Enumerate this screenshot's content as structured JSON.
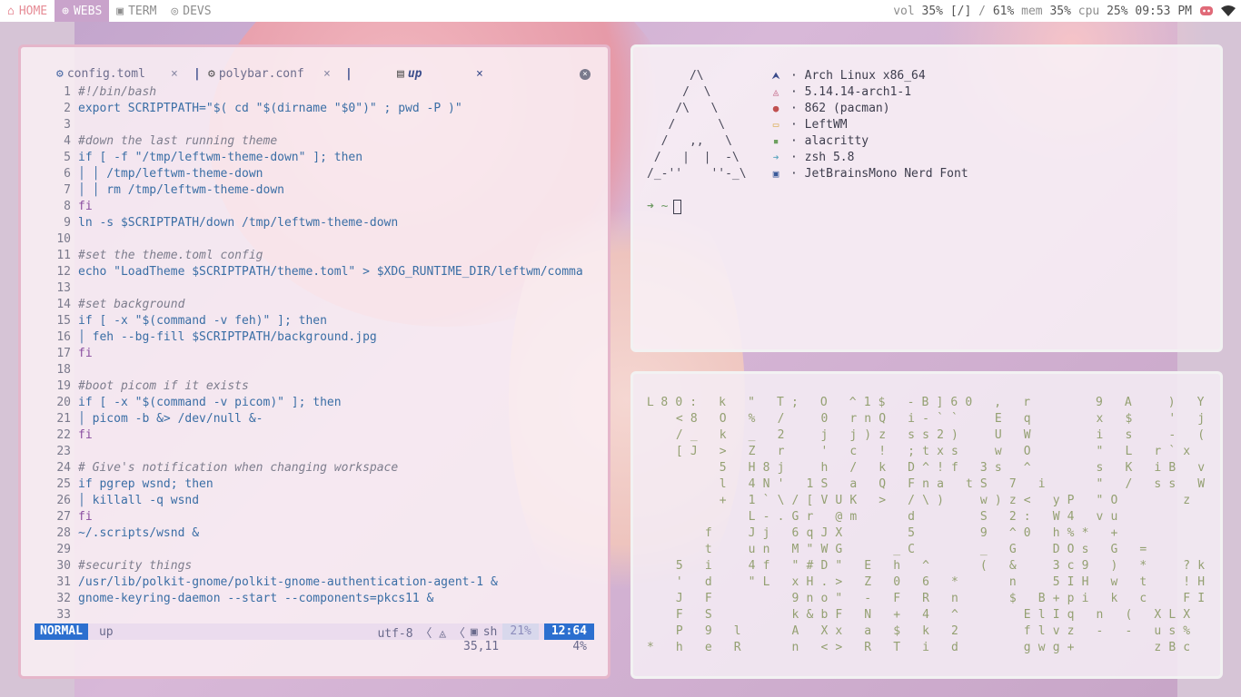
{
  "topbar": {
    "workspaces": [
      {
        "label": "HOME",
        "icon": "home-icon"
      },
      {
        "label": "WEBS",
        "icon": "globe-icon"
      },
      {
        "label": "TERM",
        "icon": "terminal-icon"
      },
      {
        "label": "DEVS",
        "icon": "github-icon"
      }
    ],
    "active_workspace": "WEBS",
    "vol_label": "vol",
    "vol_value": "35%",
    "bracket": "[/]",
    "slash": "/",
    "bat_value": "61%",
    "mem_label": "mem",
    "mem_value": "35%",
    "cpu_label": "cpu",
    "cpu_value": "25%",
    "time": "09:53 PM"
  },
  "editor": {
    "tabs": [
      {
        "label": "config.toml",
        "icon": "gear-icon"
      },
      {
        "label": "polybar.conf",
        "icon": "gear-icon"
      },
      {
        "label": "up",
        "icon": "file-icon"
      }
    ],
    "close_glyph": "×",
    "lines": [
      {
        "n": "1",
        "text": "#!/bin/bash",
        "kind": "comment"
      },
      {
        "n": "2",
        "text": "export SCRIPTPATH=\"$( cd \"$(dirname \"$0\")\" ; pwd -P )\"",
        "kind": "vi"
      },
      {
        "n": "3",
        "text": "",
        "kind": "vi"
      },
      {
        "n": "4",
        "text": "#down the last running theme",
        "kind": "comment"
      },
      {
        "n": "5",
        "text": "if [ -f \"/tmp/leftwm-theme-down\" ]; then",
        "kind": "vi"
      },
      {
        "n": "6",
        "text": "│ │ /tmp/leftwm-theme-down",
        "kind": "vi"
      },
      {
        "n": "7",
        "text": "│ │ rm /tmp/leftwm-theme-down",
        "kind": "vi"
      },
      {
        "n": "8",
        "text": "fi",
        "kind": "kw"
      },
      {
        "n": "9",
        "text": "ln -s $SCRIPTPATH/down /tmp/leftwm-theme-down",
        "kind": "vi"
      },
      {
        "n": "10",
        "text": "",
        "kind": "vi"
      },
      {
        "n": "11",
        "text": "#set the theme.toml config",
        "kind": "comment"
      },
      {
        "n": "12",
        "text": "echo \"LoadTheme $SCRIPTPATH/theme.toml\" > $XDG_RUNTIME_DIR/leftwm/comma",
        "kind": "vi"
      },
      {
        "n": "13",
        "text": "",
        "kind": "vi"
      },
      {
        "n": "14",
        "text": "#set background",
        "kind": "comment"
      },
      {
        "n": "15",
        "text": "if [ -x \"$(command -v feh)\" ]; then",
        "kind": "vi"
      },
      {
        "n": "16",
        "text": "│ feh --bg-fill $SCRIPTPATH/background.jpg",
        "kind": "vi"
      },
      {
        "n": "17",
        "text": "fi",
        "kind": "kw"
      },
      {
        "n": "18",
        "text": "",
        "kind": "vi"
      },
      {
        "n": "19",
        "text": "#boot picom if it exists",
        "kind": "comment"
      },
      {
        "n": "20",
        "text": "if [ -x \"$(command -v picom)\" ]; then",
        "kind": "vi"
      },
      {
        "n": "21",
        "text": "│ picom -b &> /dev/null &-",
        "kind": "vi"
      },
      {
        "n": "22",
        "text": "fi",
        "kind": "kw"
      },
      {
        "n": "23",
        "text": "",
        "kind": "vi"
      },
      {
        "n": "24",
        "text": "# Give's notification when changing workspace",
        "kind": "comment"
      },
      {
        "n": "25",
        "text": "if pgrep wsnd; then",
        "kind": "vi"
      },
      {
        "n": "26",
        "text": "│ killall -q wsnd",
        "kind": "vi"
      },
      {
        "n": "27",
        "text": "fi",
        "kind": "kw"
      },
      {
        "n": "28",
        "text": "~/.scripts/wsnd &",
        "kind": "vi"
      },
      {
        "n": "29",
        "text": "",
        "kind": "vi"
      },
      {
        "n": "30",
        "text": "#security things",
        "kind": "comment"
      },
      {
        "n": "31",
        "text": "/usr/lib/polkit-gnome/polkit-gnome-authentication-agent-1 &",
        "kind": "vi"
      },
      {
        "n": "32",
        "text": "gnome-keyring-daemon --start --components=pkcs11 &",
        "kind": "vi"
      },
      {
        "n": "33",
        "text": "",
        "kind": "vi"
      }
    ],
    "status": {
      "mode": "NORMAL",
      "file": "up",
      "encoding": "utf-8 〈 ◬ 〈",
      "filetype": "sh",
      "percent": "21%",
      "position": "12:64",
      "rowcol": "35,11",
      "scroll": "4%"
    }
  },
  "fetch": {
    "ascii": "      /\\\n     /  \\\n    /\\   \\\n   /      \\\n  /   ,,   \\\n /   |  |  -\\\n/_-''    ''-_\\",
    "rows": [
      {
        "icon": "arch-icon",
        "text": "· Arch Linux x86_64",
        "color": "#3a4a8a",
        "glyph": "⮝"
      },
      {
        "icon": "kernel-icon",
        "text": "· 5.14.14-arch1-1",
        "color": "#c06080",
        "glyph": "◬"
      },
      {
        "icon": "package-icon",
        "text": "· 862 (pacman)",
        "color": "#c05050",
        "glyph": "●"
      },
      {
        "icon": "wm-icon",
        "text": "· LeftWM",
        "color": "#d8a848",
        "glyph": "▭"
      },
      {
        "icon": "terminal-icon",
        "text": "· alacritty",
        "color": "#6ea060",
        "glyph": "▪"
      },
      {
        "icon": "shell-icon",
        "text": "· zsh 5.8",
        "color": "#60a8c0",
        "glyph": "➜"
      },
      {
        "icon": "font-icon",
        "text": "· JetBrainsMono Nerd Font",
        "color": "#3a5a9a",
        "glyph": "▣"
      }
    ],
    "prompt": "➜ ~"
  },
  "matrix": {
    "rows": [
      "ᒪ 8 0 :   k   \"   T ;   O   ^ 1 $   - B ] 6 0   ,   r         9   A     )   Y",
      "    < 8   O   %   /     0   r n Q   i - ` `     E   q         x   $     '   j",
      "    / _   k   _   2     j   j ) z   s s 2 )     U   W         i   s     -   (",
      "    [ J   >   Z   r     '   c   !   ; t x s     w   O         \"   L   r ` x",
      "          5   H 8 j     h   /   k   D ^ ! f   3 s   ^         s   K   i B   v",
      "          l   4 N '   1 S   a   Q   F n a   t S   7   i       \"   /   s s   W",
      "          +   1 ` \\ / [ V U K   >   / \\ )     w ) z <   y P   \" O         z",
      "              L - . G r   @ m       d         S   2 :   W 4   v u",
      "        f     J j   6 q J X         5         9   ^ 0   h % *   +",
      "        t     u n   M \" W G       _ C         _   G     D O s   G   =",
      "    5   i     4 f   \" # D \"   E   h   ^       (   &     3 c 9   )   *     ? k",
      "    '   d     \" L   x H . >   Z   0   6   *       n     5 I H   w   t     ! H",
      "    J   F           9 n o \"   -   F   R   n       $   B + p i   k   c     F I",
      "    F   S           k & b F   N   +   4   ^         E l I q   n   (   X L X",
      "    P   9   l       A   X x   a   $   k   2         f l v z   -   -   u s %",
      "*   h   e   R       n   < >   R   T   i   d         g w g +           z B c"
    ]
  }
}
